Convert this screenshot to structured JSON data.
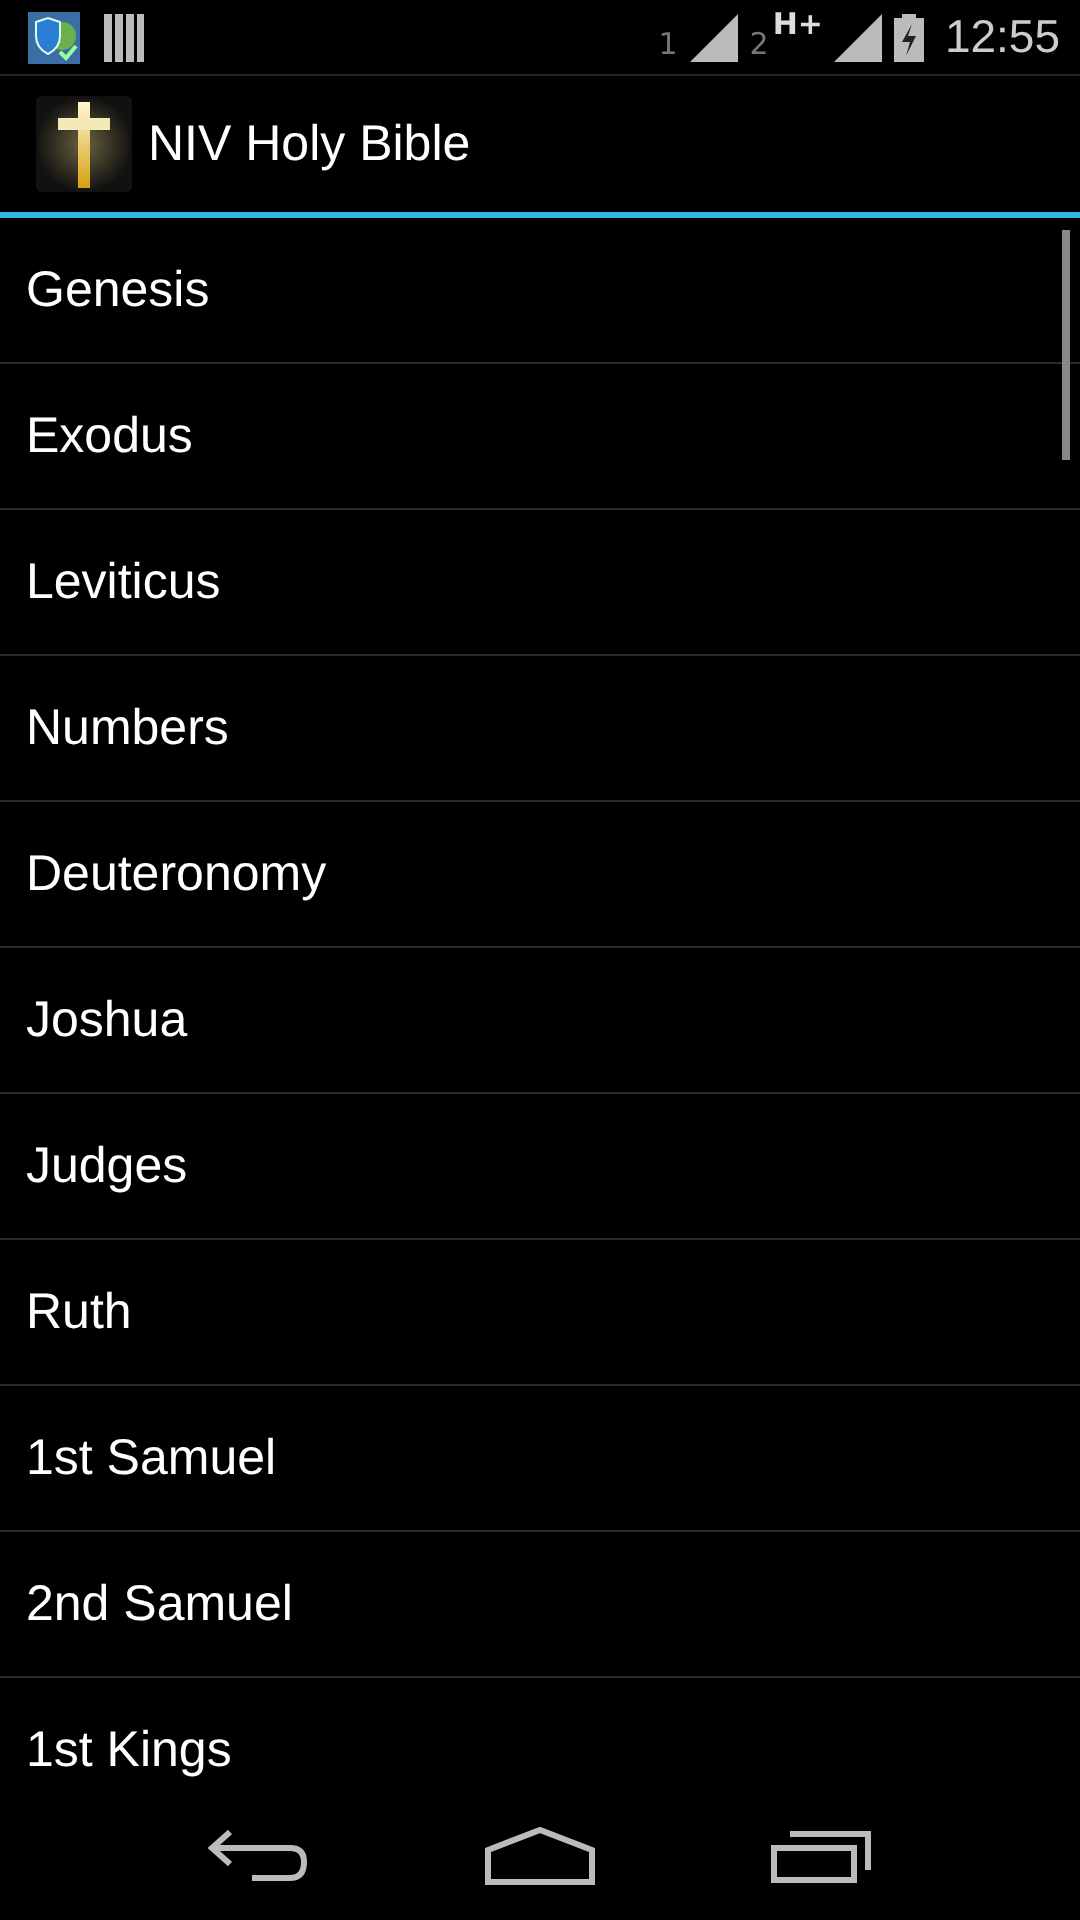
{
  "status_bar": {
    "sim_1": "1",
    "sim_2": "2",
    "network_type": "H+",
    "time": "12:55"
  },
  "action_bar": {
    "title": "NIV Holy Bible"
  },
  "books": [
    "Genesis",
    "Exodus",
    "Leviticus",
    "Numbers",
    "Deuteronomy",
    "Joshua",
    "Judges",
    "Ruth",
    "1st Samuel",
    "2nd Samuel",
    "1st Kings"
  ]
}
